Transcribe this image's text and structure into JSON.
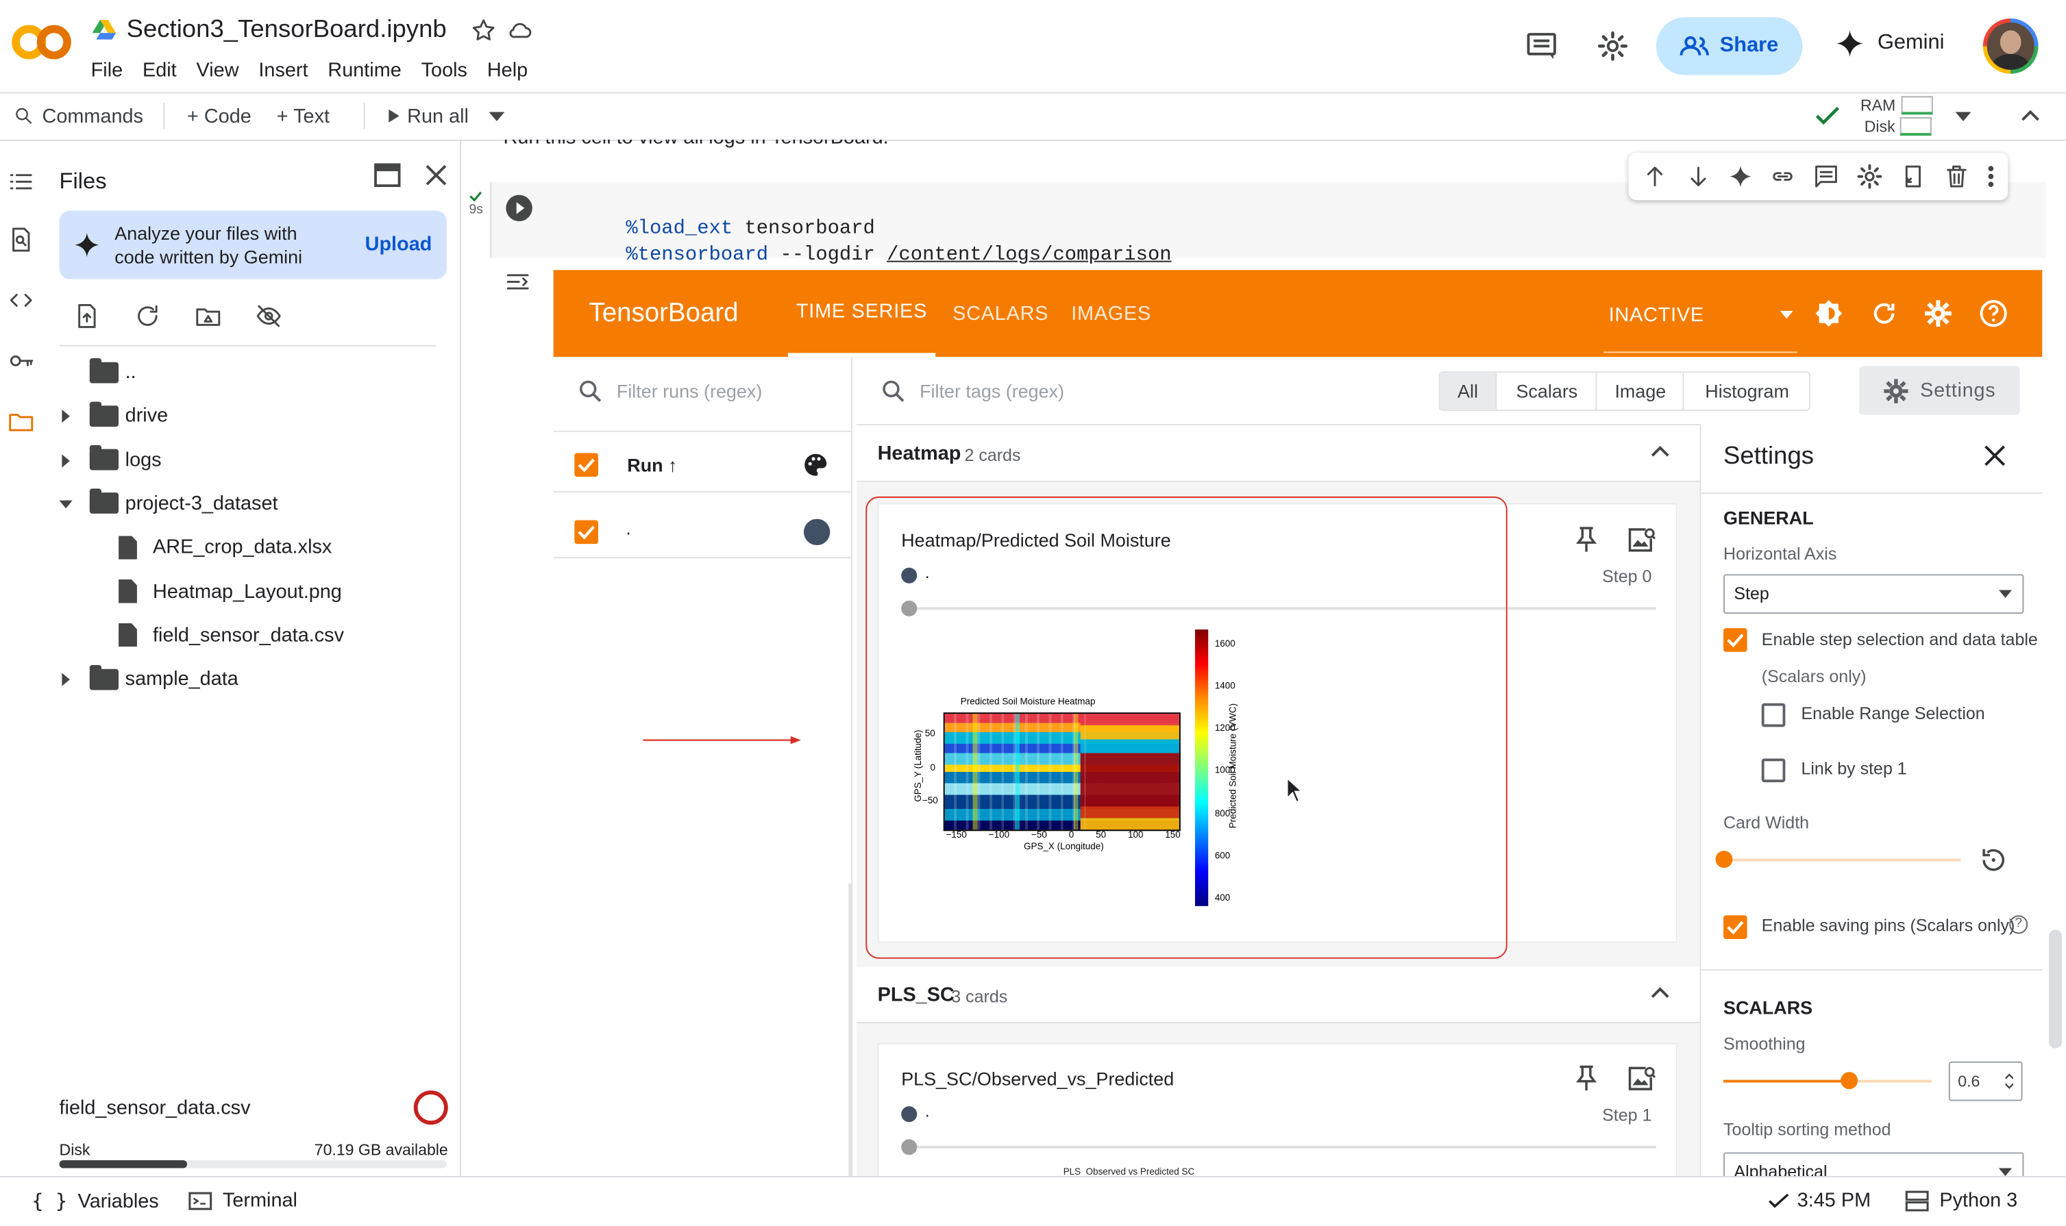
{
  "app": {
    "logo_text": "CO",
    "notebook_title": "Section3_TensorBoard.ipynb",
    "menu": [
      "File",
      "Edit",
      "View",
      "Insert",
      "Runtime",
      "Tools",
      "Help"
    ],
    "share_label": "Share",
    "gemini_label": "Gemini"
  },
  "toolbar": {
    "commands": "Commands",
    "code": "+ Code",
    "text": "+ Text",
    "run_all": "Run all",
    "ram": "RAM",
    "disk": "Disk"
  },
  "files_panel": {
    "title": "Files",
    "banner_text": "Analyze your files with code written by Gemini",
    "upload": "Upload",
    "tree": [
      {
        "name": "..",
        "type": "folder-open",
        "depth": 0,
        "expand": ""
      },
      {
        "name": "drive",
        "type": "folder",
        "depth": 0,
        "expand": "closed"
      },
      {
        "name": "logs",
        "type": "folder",
        "depth": 0,
        "expand": "closed"
      },
      {
        "name": "project-3_dataset",
        "type": "folder",
        "depth": 0,
        "expand": "open"
      },
      {
        "name": "ARE_crop_data.xlsx",
        "type": "file",
        "depth": 1,
        "expand": ""
      },
      {
        "name": "Heatmap_Layout.png",
        "type": "file",
        "depth": 1,
        "expand": ""
      },
      {
        "name": "field_sensor_data.csv",
        "type": "file",
        "depth": 1,
        "expand": ""
      },
      {
        "name": "sample_data",
        "type": "folder",
        "depth": 0,
        "expand": "closed"
      }
    ],
    "selected_file": "field_sensor_data.csv",
    "disk_label": "Disk",
    "disk_available": "70.19 GB available",
    "disk_used_fraction": 0.33
  },
  "cell": {
    "header_text": "Run this cell to view all logs in TensorBoard.",
    "exec_time": "9s",
    "line1_magic": "%load_ext",
    "line1_arg": " tensorboard",
    "line2_magic": "%tensorboard",
    "line2_flag": " --logdir ",
    "line2_path": "/content/logs/comparison"
  },
  "tensorboard": {
    "brand": "TensorBoard",
    "tabs": [
      "TIME SERIES",
      "SCALARS",
      "IMAGES"
    ],
    "status": "INACTIVE",
    "filter_runs_placeholder": "Filter runs (regex)",
    "filter_tags_placeholder": "Filter tags (regex)",
    "type_filters": [
      "All",
      "Scalars",
      "Image",
      "Histogram"
    ],
    "settings_button": "Settings",
    "runs_header": "Run ↑",
    "run_name": ".",
    "groups": [
      {
        "name": "Heatmap",
        "count": "2 cards"
      },
      {
        "name": "PLS_SC",
        "count": "3 cards"
      }
    ],
    "cards": [
      {
        "title": "Heatmap/Predicted Soil Moisture",
        "run": ".",
        "step": "Step 0"
      },
      {
        "title": "PLS_SC/Observed_vs_Predicted",
        "run": ".",
        "step": "Step 1"
      }
    ],
    "heatmap_image": {
      "title": "Predicted Soil Moisture Heatmap",
      "xlabel": "GPS_X (Longitude)",
      "ylabel": "GPS_Y (Latitude)",
      "x_ticks": [
        "−150",
        "−100",
        "−50",
        "0",
        "50",
        "100",
        "150"
      ],
      "y_ticks": [
        "50",
        "0",
        "−50"
      ],
      "colorbar_label": "Predicted Soil Moisture (VWC)",
      "colorbar_ticks": [
        "1600",
        "1400",
        "1200",
        "1000",
        "800",
        "600",
        "400"
      ]
    },
    "pls_image_title": "PLS_Observed vs Predicted SC"
  },
  "settings_panel": {
    "title": "Settings",
    "general": "GENERAL",
    "horizontal_axis_label": "Horizontal Axis",
    "horizontal_axis_value": "Step",
    "enable_step_selection": "Enable step selection and data table",
    "scalars_only": "(Scalars only)",
    "enable_range_selection": "Enable Range Selection",
    "link_by_step": "Link by step 1",
    "card_width": "Card Width",
    "card_width_fraction": 0.0,
    "enable_saving_pins": "Enable saving pins (Scalars only)",
    "scalars_heading": "SCALARS",
    "smoothing_label": "Smoothing",
    "smoothing_value": "0.6",
    "smoothing_fraction": 0.6,
    "tooltip_label": "Tooltip sorting method",
    "tooltip_value": "Alphabetical"
  },
  "footer": {
    "variables": "Variables",
    "terminal": "Terminal",
    "time": "3:45 PM",
    "kernel": "Python 3"
  },
  "colors": {
    "accent": "#f57c00",
    "share_bg": "#c2e7ff",
    "run_dot": "#425066",
    "selection_outline": "#d93025"
  }
}
